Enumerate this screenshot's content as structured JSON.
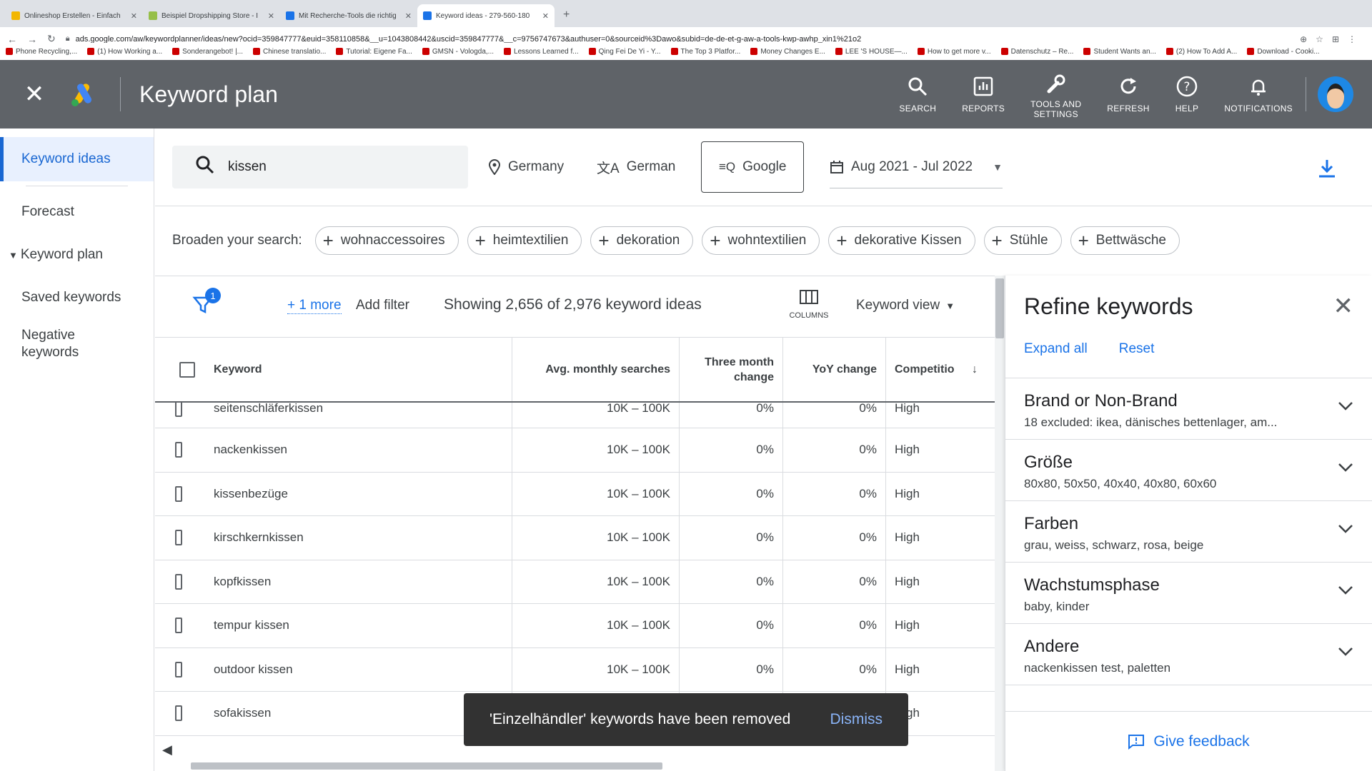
{
  "browser": {
    "tabs": [
      {
        "title": "Onlineshop Erstellen - Einfach",
        "color": "#f2b600"
      },
      {
        "title": "Beispiel Dropshipping Store - I",
        "color": "#96bf48"
      },
      {
        "title": "Mit Recherche-Tools die richtig",
        "color": "#1a73e8"
      },
      {
        "title": "Keyword ideas - 279-560-180",
        "color": "#1a73e8"
      }
    ],
    "url": "ads.google.com/aw/keywordplanner/ideas/new?ocid=359847777&euid=358110858&__u=1043808442&uscid=359847777&__c=9756747673&authuser=0&sourceid%3Dawo&subid=de-de-et-g-aw-a-tools-kwp-awhp_xin1%21o2",
    "bookmarks": [
      "Phone Recycling,...",
      "(1) How Working a...",
      "Sonderangebot! |...",
      "Chinese translatio...",
      "Tutorial: Eigene Fa...",
      "GMSN - Vologda,...",
      "Lessons Learned f...",
      "Qing Fei De Yi - Y...",
      "The Top 3 Platfor...",
      "Money Changes E...",
      "LEE 'S HOUSE—...",
      "How to get more v...",
      "Datenschutz – Re...",
      "Student Wants an...",
      "(2) How To Add A...",
      "Download - Cooki..."
    ]
  },
  "header": {
    "title": "Keyword plan",
    "buttons": {
      "search": "SEARCH",
      "reports": "REPORTS",
      "tools_line1": "TOOLS AND",
      "tools_line2": "SETTINGS",
      "refresh": "REFRESH",
      "help": "HELP",
      "notifications": "NOTIFICATIONS"
    }
  },
  "sidebar": {
    "items": [
      {
        "label": "Keyword ideas"
      },
      {
        "label": "Forecast"
      },
      {
        "label": "Keyword plan"
      },
      {
        "label": "Saved keywords"
      },
      {
        "label": "Negative keywords"
      }
    ]
  },
  "search": {
    "query": "kissen",
    "location": "Germany",
    "language": "German",
    "network": "Google",
    "date_range": "Aug 2021 - Jul 2022"
  },
  "broaden": {
    "label": "Broaden your search:",
    "chips": [
      "wohnaccessoires",
      "heimtextilien",
      "dekoration",
      "wohntextilien",
      "dekorative Kissen",
      "Stühle",
      "Bettwäsche"
    ]
  },
  "toolbar": {
    "filter_count": "1",
    "more": "+ 1 more",
    "add_filter": "Add filter",
    "showing": "Showing 2,656 of 2,976 keyword ideas",
    "columns": "COLUMNS",
    "view": "Keyword view"
  },
  "table": {
    "headers": {
      "keyword": "Keyword",
      "avg": "Avg. monthly searches",
      "three_month_1": "Three month",
      "three_month_2": "change",
      "yoy": "YoY change",
      "competition": "Competitio"
    },
    "rows": [
      {
        "keyword": "seitenschläferkissen",
        "avg": "10K – 100K",
        "three": "0%",
        "yoy": "0%",
        "comp": "High"
      },
      {
        "keyword": "nackenkissen",
        "avg": "10K – 100K",
        "three": "0%",
        "yoy": "0%",
        "comp": "High"
      },
      {
        "keyword": "kissenbezüge",
        "avg": "10K – 100K",
        "three": "0%",
        "yoy": "0%",
        "comp": "High"
      },
      {
        "keyword": "kirschkernkissen",
        "avg": "10K – 100K",
        "three": "0%",
        "yoy": "0%",
        "comp": "High"
      },
      {
        "keyword": "kopfkissen",
        "avg": "10K – 100K",
        "three": "0%",
        "yoy": "0%",
        "comp": "High"
      },
      {
        "keyword": "tempur kissen",
        "avg": "10K – 100K",
        "three": "0%",
        "yoy": "0%",
        "comp": "High"
      },
      {
        "keyword": "outdoor kissen",
        "avg": "10K – 100K",
        "three": "0%",
        "yoy": "0%",
        "comp": "High"
      },
      {
        "keyword": "sofakissen",
        "avg": "",
        "three": "",
        "yoy": "",
        "comp": "High"
      }
    ]
  },
  "snackbar": {
    "message": "'Einzelhändler' keywords have been removed",
    "action": "Dismiss"
  },
  "refine": {
    "title": "Refine keywords",
    "expand_all": "Expand all",
    "reset": "Reset",
    "sections": [
      {
        "title": "Brand or Non-Brand",
        "sub": "18 excluded: ikea, dänisches bettenlager, am..."
      },
      {
        "title": "Größe",
        "sub": "80x80, 50x50, 40x40, 40x80, 60x60"
      },
      {
        "title": "Farben",
        "sub": "grau, weiss, schwarz, rosa, beige"
      },
      {
        "title": "Wachstumsphase",
        "sub": "baby, kinder"
      },
      {
        "title": "Andere",
        "sub": "nackenkissen test, paletten"
      }
    ],
    "feedback": "Give feedback"
  }
}
